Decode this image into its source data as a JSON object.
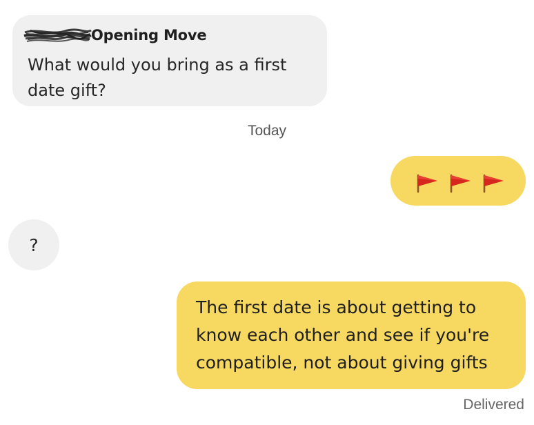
{
  "conversation": {
    "opening_move": {
      "label": "Opening Move",
      "question": "What would you bring as a first date gift?"
    },
    "date_separator": "Today",
    "messages": [
      {
        "direction": "outgoing",
        "content": [
          "red-flag-icon",
          "red-flag-icon",
          "red-flag-icon"
        ]
      },
      {
        "direction": "incoming",
        "text": "?"
      },
      {
        "direction": "outgoing",
        "lines": [
          "The first date is about getting to",
          "know each other and see if you're",
          "compatible, not about giving gifts"
        ]
      }
    ],
    "status": "Delivered"
  },
  "colors": {
    "incoming_bubble": "#f0f0f0",
    "outgoing_bubble": "#f7d861",
    "flag_red": "#d7261e",
    "flag_pole": "#8a5a2b"
  }
}
